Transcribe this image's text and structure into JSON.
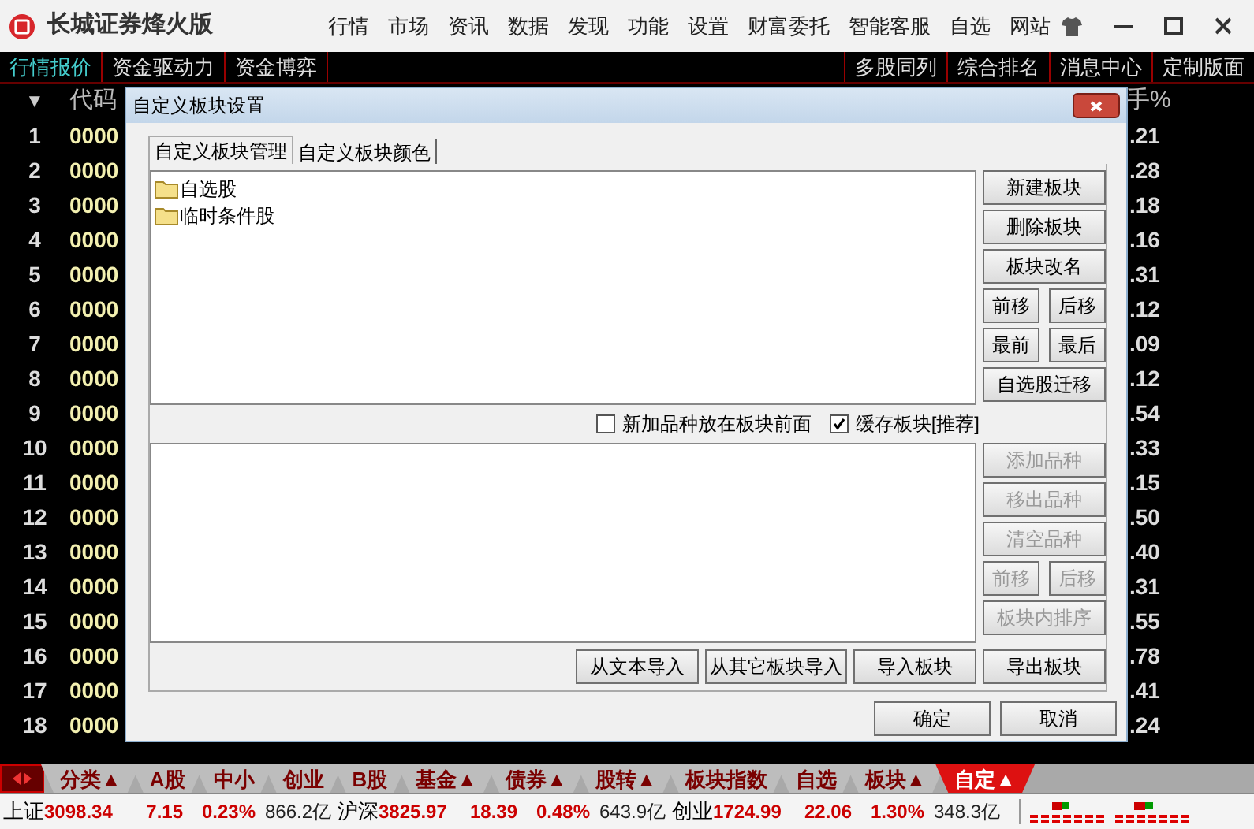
{
  "app": {
    "title": "长城证券烽火版",
    "menu": [
      "行情",
      "市场",
      "资讯",
      "数据",
      "发现",
      "功能",
      "设置",
      "财富委托",
      "智能客服",
      "自选",
      "网站"
    ]
  },
  "toolbar": {
    "left_tabs": [
      {
        "label": "行情报价",
        "selected": true
      },
      {
        "label": "资金驱动力",
        "selected": false
      },
      {
        "label": "资金博弈",
        "selected": false
      }
    ],
    "right_tabs": [
      {
        "label": "多股同列"
      },
      {
        "label": "综合排名"
      },
      {
        "label": "消息中心"
      },
      {
        "label": "定制版面"
      }
    ]
  },
  "quote_table": {
    "header": {
      "sort_marker": "▼",
      "column_1": "代码",
      "column_last": "手%"
    },
    "rows": [
      {
        "index": "1",
        "code": "0000",
        "column_last": ".21"
      },
      {
        "index": "2",
        "code": "0000",
        "column_last": ".28"
      },
      {
        "index": "3",
        "code": "0000",
        "column_last": ".18"
      },
      {
        "index": "4",
        "code": "0000",
        "column_last": ".16"
      },
      {
        "index": "5",
        "code": "0000",
        "column_last": ".31"
      },
      {
        "index": "6",
        "code": "0000",
        "column_last": ".12"
      },
      {
        "index": "7",
        "code": "0000",
        "column_last": ".09"
      },
      {
        "index": "8",
        "code": "0000",
        "column_last": ".12"
      },
      {
        "index": "9",
        "code": "0000",
        "column_last": ".54"
      },
      {
        "index": "10",
        "code": "0000",
        "column_last": ".33"
      },
      {
        "index": "11",
        "code": "0000",
        "column_last": ".15"
      },
      {
        "index": "12",
        "code": "0000",
        "column_last": ".50"
      },
      {
        "index": "13",
        "code": "0000",
        "column_last": ".40"
      },
      {
        "index": "14",
        "code": "0000",
        "column_last": ".31"
      },
      {
        "index": "15",
        "code": "0000",
        "column_last": ".55"
      },
      {
        "index": "16",
        "code": "0000",
        "column_last": ".78"
      },
      {
        "index": "17",
        "code": "0000",
        "column_last": ".41"
      },
      {
        "index": "18",
        "code": "0000",
        "column_last": ".24"
      }
    ]
  },
  "dialog": {
    "title": "自定义板块设置",
    "tabs": [
      {
        "label": "自定义板块管理",
        "selected": true
      },
      {
        "label": "自定义板块颜色",
        "selected": false
      }
    ],
    "block_list": [
      {
        "label": "自选股"
      },
      {
        "label": "临时条件股"
      }
    ],
    "block_buttons": [
      [
        {
          "label": "新建板块",
          "disabled": false
        }
      ],
      [
        {
          "label": "删除板块",
          "disabled": false
        }
      ],
      [
        {
          "label": "板块改名",
          "disabled": false
        }
      ],
      [
        {
          "label": "前移",
          "disabled": false
        },
        {
          "label": "后移",
          "disabled": false
        }
      ],
      [
        {
          "label": "最前",
          "disabled": false
        },
        {
          "label": "最后",
          "disabled": false
        }
      ],
      [
        {
          "label": "自选股迁移",
          "disabled": false
        }
      ]
    ],
    "options": [
      {
        "label": "新加品种放在板块前面",
        "checked": false
      },
      {
        "label": "缓存板块[推荐]",
        "checked": true
      }
    ],
    "stock_buttons": [
      [
        {
          "label": "添加品种",
          "disabled": true
        }
      ],
      [
        {
          "label": "移出品种",
          "disabled": true
        }
      ],
      [
        {
          "label": "清空品种",
          "disabled": true
        }
      ],
      [
        {
          "label": "前移",
          "disabled": true
        },
        {
          "label": "后移",
          "disabled": true
        }
      ],
      [
        {
          "label": "板块内排序",
          "disabled": true
        }
      ]
    ],
    "import_buttons": [
      {
        "label": "从文本导入"
      },
      {
        "label": "从其它板块导入"
      },
      {
        "label": "导入板块"
      },
      {
        "label": "导出板块"
      }
    ],
    "footer_buttons": [
      {
        "label": "确定"
      },
      {
        "label": "取消"
      }
    ]
  },
  "category_tabs": [
    {
      "label": "分类▲",
      "selected": false
    },
    {
      "label": "A股",
      "selected": false
    },
    {
      "label": "中小",
      "selected": false
    },
    {
      "label": "创业",
      "selected": false
    },
    {
      "label": "B股",
      "selected": false
    },
    {
      "label": "基金▲",
      "selected": false
    },
    {
      "label": "债券▲",
      "selected": false
    },
    {
      "label": "股转▲",
      "selected": false
    },
    {
      "label": "板块指数",
      "selected": false
    },
    {
      "label": "自选",
      "selected": false
    },
    {
      "label": "板块▲",
      "selected": false
    },
    {
      "label": "自定▲",
      "selected": true
    }
  ],
  "market_status": [
    {
      "name": "上证",
      "index": "3098.34",
      "change": "7.15",
      "percent": "0.23%",
      "volume": "866.2亿"
    },
    {
      "name": "沪深",
      "index": "3825.97",
      "change": "18.39",
      "percent": "0.48%",
      "volume": "643.9亿"
    },
    {
      "name": "创业",
      "index": "1724.99",
      "change": "22.06",
      "percent": "1.30%",
      "volume": "348.3亿"
    }
  ]
}
